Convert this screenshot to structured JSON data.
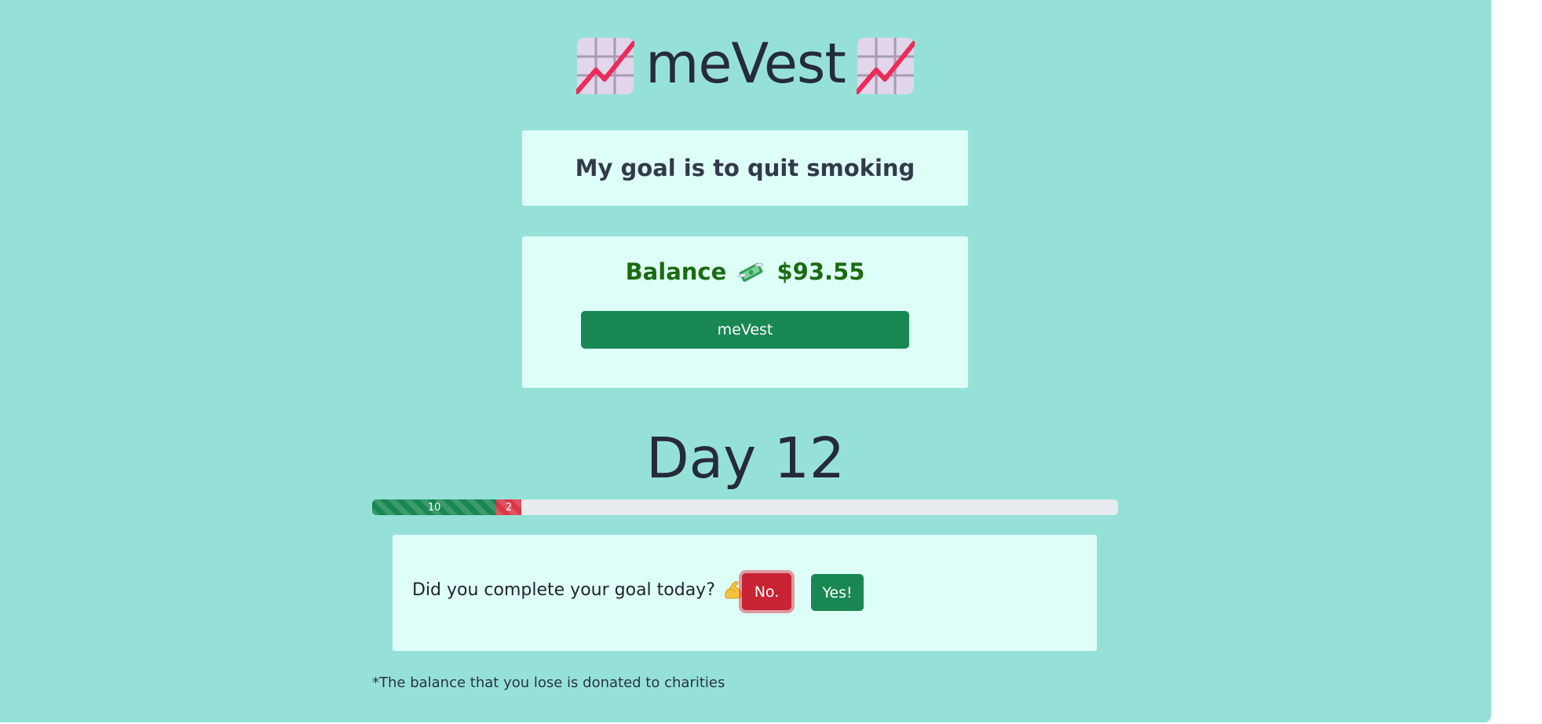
{
  "header": {
    "title": "meVest",
    "left_icon": "chart-increasing-icon",
    "right_icon": "chart-increasing-icon"
  },
  "goal": {
    "text": "My goal is to quit smoking"
  },
  "balance": {
    "label": "Balance",
    "icon": "money-with-wings-icon",
    "amount": "$93.55",
    "button_label": "meVest"
  },
  "day": {
    "title": "Day 12"
  },
  "progress": {
    "total_days_scale": 60,
    "segments": [
      {
        "label": "10",
        "value": 10,
        "status": "success",
        "color": "#198754"
      },
      {
        "label": "2",
        "value": 2,
        "status": "danger",
        "color": "#dc3545"
      }
    ]
  },
  "checkin": {
    "question": "Did you complete your goal today?",
    "icon": "flexed-biceps-icon",
    "no_label": "No.",
    "yes_label": "Yes!"
  },
  "footnote": "*The balance that you lose is donated to charities",
  "colors": {
    "background": "#95e1d8",
    "card": "#defff8",
    "success": "#198754",
    "danger": "#dc3545",
    "title_text": "#262a3d",
    "balance_text": "#1b6b10"
  }
}
